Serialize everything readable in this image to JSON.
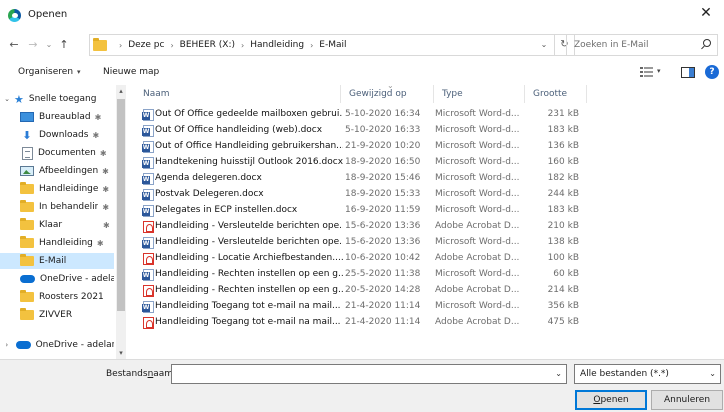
{
  "window": {
    "title": "Openen",
    "close_glyph": "✕"
  },
  "nav_buttons": {
    "back": "←",
    "forward": "→",
    "recent": "⌄",
    "up": "↑"
  },
  "address": {
    "crumbs": [
      "Deze pc",
      "BEHEER (X:)",
      "Handleiding",
      "E-Mail"
    ],
    "separator": "›",
    "refresh": "↻",
    "dropdown": "⌄"
  },
  "search": {
    "placeholder": "Zoeken in E-Mail"
  },
  "toolbar": {
    "organize": "Organiseren",
    "organize_caret": "▾",
    "new_folder": "Nieuwe map",
    "view_caret": "▾",
    "help": "?"
  },
  "nav_pane": {
    "items": [
      {
        "label": "Snelle toegang",
        "icon": "star-icon",
        "expander": "⌄",
        "pin": ""
      },
      {
        "label": "Bureaublad",
        "icon": "desktop-icon",
        "pin": "📌"
      },
      {
        "label": "Downloads",
        "icon": "download-icon",
        "pin": "📌"
      },
      {
        "label": "Documenten",
        "icon": "documents-icon",
        "pin": "📌"
      },
      {
        "label": "Afbeeldingen",
        "icon": "pictures-icon",
        "pin": "📌"
      },
      {
        "label": "Handleidinge",
        "icon": "folder-icon",
        "pin": "📌"
      },
      {
        "label": "In behandelir",
        "icon": "folder-icon",
        "pin": "📌"
      },
      {
        "label": "Klaar",
        "icon": "folder-icon",
        "pin": "📌"
      },
      {
        "label": "Handleiding",
        "icon": "folder-icon",
        "pin": "📌"
      },
      {
        "label": "E-Mail",
        "icon": "folder-icon",
        "pin": "",
        "selected": true
      },
      {
        "label": "OneDrive - adela",
        "icon": "onedrive-icon",
        "pin": ""
      },
      {
        "label": "Roosters 2021",
        "icon": "folder-icon",
        "pin": ""
      },
      {
        "label": "ZIVVER",
        "icon": "folder-icon",
        "pin": ""
      },
      {
        "label": "OneDrive - adelan",
        "icon": "onedrive-icon",
        "expander": "›",
        "pin": ""
      }
    ],
    "scroll_up": "▴",
    "scroll_down": "▾"
  },
  "file_list": {
    "columns": {
      "name": "Naam",
      "date": "Gewijzigd op",
      "type": "Type",
      "size": "Grootte",
      "sort_indicator": "⌄"
    },
    "files": [
      {
        "name": "Out Of Office gedeelde mailboxen gebrui...",
        "date": "5-10-2020 16:34",
        "type": "Microsoft Word-d...",
        "size": "231 kB",
        "kind": "word"
      },
      {
        "name": "Out Of Office handleiding (web).docx",
        "date": "5-10-2020 16:33",
        "type": "Microsoft Word-d...",
        "size": "183 kB",
        "kind": "word"
      },
      {
        "name": "Out of Office Handleiding gebruikershan...",
        "date": "21-9-2020 10:20",
        "type": "Microsoft Word-d...",
        "size": "136 kB",
        "kind": "word"
      },
      {
        "name": "Handtekening huisstijl Outlook 2016.docx",
        "date": "18-9-2020 16:50",
        "type": "Microsoft Word-d...",
        "size": "160 kB",
        "kind": "word"
      },
      {
        "name": "Agenda delegeren.docx",
        "date": "18-9-2020 15:46",
        "type": "Microsoft Word-d...",
        "size": "182 kB",
        "kind": "word"
      },
      {
        "name": "Postvak Delegeren.docx",
        "date": "18-9-2020 15:33",
        "type": "Microsoft Word-d...",
        "size": "244 kB",
        "kind": "word"
      },
      {
        "name": "Delegates in ECP instellen.docx",
        "date": "16-9-2020 11:59",
        "type": "Microsoft Word-d...",
        "size": "183 kB",
        "kind": "word"
      },
      {
        "name": "Handleiding - Versleutelde berichten ope...",
        "date": "15-6-2020 13:36",
        "type": "Adobe Acrobat D...",
        "size": "210 kB",
        "kind": "pdf"
      },
      {
        "name": "Handleiding - Versleutelde berichten ope...",
        "date": "15-6-2020 13:36",
        "type": "Microsoft Word-d...",
        "size": "138 kB",
        "kind": "word"
      },
      {
        "name": "Handleiding - Locatie Archiefbestanden....",
        "date": "10-6-2020 10:42",
        "type": "Adobe Acrobat D...",
        "size": "100 kB",
        "kind": "pdf"
      },
      {
        "name": "Handleiding - Rechten instellen op een g...",
        "date": "25-5-2020 11:38",
        "type": "Microsoft Word-d...",
        "size": "60 kB",
        "kind": "word"
      },
      {
        "name": "Handleiding - Rechten instellen op een g...",
        "date": "20-5-2020 14:28",
        "type": "Adobe Acrobat D...",
        "size": "214 kB",
        "kind": "pdf"
      },
      {
        "name": "Handleiding Toegang tot e-mail na mail...",
        "date": "21-4-2020 11:14",
        "type": "Microsoft Word-d...",
        "size": "356 kB",
        "kind": "word"
      },
      {
        "name": "Handleiding Toegang tot e-mail na mail...",
        "date": "21-4-2020 11:14",
        "type": "Adobe Acrobat D...",
        "size": "475 kB",
        "kind": "pdf"
      }
    ]
  },
  "footer": {
    "filename_label_pre": "Bestands",
    "filename_label_u": "n",
    "filename_label_post": "aam:",
    "filename_value": "",
    "filename_dropdown": "⌄",
    "filter_value": "Alle bestanden (*.*)",
    "filter_dropdown": "⌄",
    "open_u": "O",
    "open_rest": "penen",
    "cancel": "Annuleren"
  },
  "colors": {
    "selection": "#cce8ff",
    "accent": "#0078d7",
    "header_text": "#4c607a",
    "folder": "#f3c23f"
  }
}
